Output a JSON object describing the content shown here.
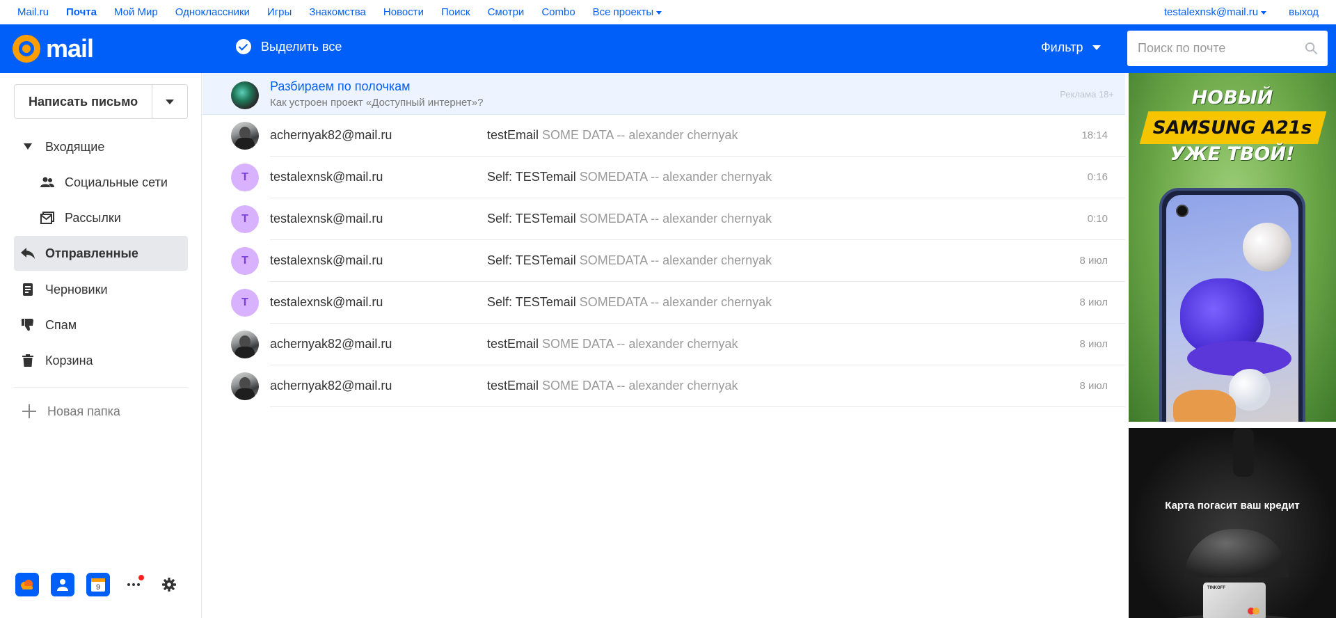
{
  "portal": {
    "links": [
      "Mail.ru",
      "Почта",
      "Мой Мир",
      "Одноклассники",
      "Игры",
      "Знакомства",
      "Новости",
      "Поиск",
      "Смотри",
      "Combo",
      "Все проекты"
    ],
    "user": "testalexnsk@mail.ru",
    "logout": "выход"
  },
  "header": {
    "logo_text": "mail",
    "select_all": "Выделить все",
    "filter": "Фильтр",
    "search_placeholder": "Поиск по почте"
  },
  "sidebar": {
    "compose": "Написать письмо",
    "folders": [
      {
        "label": "Входящие",
        "icon": "triangle-down-icon"
      },
      {
        "label": "Социальные сети",
        "icon": "people-icon"
      },
      {
        "label": "Рассылки",
        "icon": "newsletter-icon"
      },
      {
        "label": "Отправленные",
        "icon": "reply-icon",
        "active": true
      },
      {
        "label": "Черновики",
        "icon": "draft-icon"
      },
      {
        "label": "Спам",
        "icon": "thumb-down-icon"
      },
      {
        "label": "Корзина",
        "icon": "trash-icon"
      }
    ],
    "new_folder": "Новая папка",
    "calendar_day": "9"
  },
  "ad_row": {
    "title": "Разбираем по полочкам",
    "subtitle": "Как устроен проект «Доступный интернет»?",
    "label": "Реклама 18+"
  },
  "messages": [
    {
      "sender": "achernyak82@mail.ru",
      "subject": "testEmail",
      "snippet": "SOME DATA -- alexander chernyak",
      "date": "18:14",
      "avatar": "photo"
    },
    {
      "sender": "testalexnsk@mail.ru",
      "subject": "Self: TESTemail",
      "snippet": "SOMEDATA -- alexander chernyak",
      "date": "0:16",
      "avatar": "T"
    },
    {
      "sender": "testalexnsk@mail.ru",
      "subject": "Self: TESTemail",
      "snippet": "SOMEDATA -- alexander chernyak",
      "date": "0:10",
      "avatar": "T"
    },
    {
      "sender": "testalexnsk@mail.ru",
      "subject": "Self: TESTemail",
      "snippet": "SOMEDATA -- alexander chernyak",
      "date": "8 июл",
      "avatar": "T"
    },
    {
      "sender": "testalexnsk@mail.ru",
      "subject": "Self: TESTemail",
      "snippet": "SOMEDATA -- alexander chernyak",
      "date": "8 июл",
      "avatar": "T"
    },
    {
      "sender": "achernyak82@mail.ru",
      "subject": "testEmail",
      "snippet": "SOME DATA -- alexander chernyak",
      "date": "8 июл",
      "avatar": "photo"
    },
    {
      "sender": "achernyak82@mail.ru",
      "subject": "testEmail",
      "snippet": "SOME DATA -- alexander chernyak",
      "date": "8 июл",
      "avatar": "photo"
    }
  ],
  "banner1": {
    "line1": "НОВЫЙ",
    "line2": "SAMSUNG A21s",
    "line3": "УЖЕ ТВОЙ!"
  },
  "banner2": {
    "text": "Карта погасит ваш кредит",
    "card_brand": "TINKOFF"
  },
  "colors": {
    "brand_blue": "#005ff9",
    "logo_orange": "#ff9e00",
    "letter_avatar_bg": "#d9b2ff",
    "notification_dot": "#ff1f1f"
  }
}
